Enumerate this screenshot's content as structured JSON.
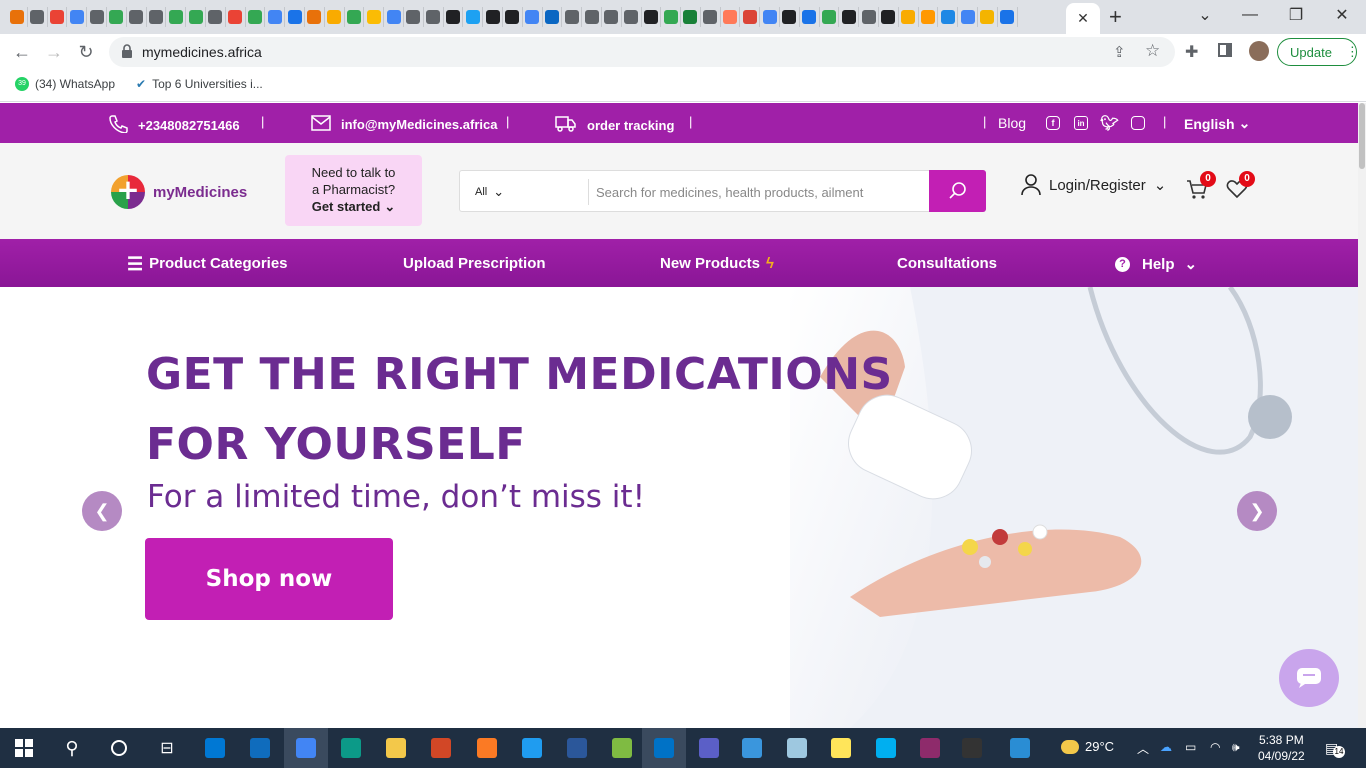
{
  "browser": {
    "url": "mymedicines.africa",
    "update_label": "Update",
    "bookmarks": [
      {
        "label": "(34) WhatsApp",
        "badge": "39"
      },
      {
        "label": "Top 6 Universities i..."
      }
    ]
  },
  "site": {
    "topbar": {
      "phone": "+2348082751466",
      "email": "info@myMedicines.africa",
      "tracking": "order tracking",
      "blog": "Blog",
      "language": "English"
    },
    "header": {
      "logo_text": "myMedicines",
      "pharmacist_line1": "Need to talk to",
      "pharmacist_line2": "a Pharmacist?",
      "pharmacist_cta": "Get started",
      "search_category": "All",
      "search_placeholder": "Search for medicines, health products, ailment",
      "login_label": "Login/Register",
      "cart_count": "0",
      "wishlist_count": "0"
    },
    "nav": {
      "categories": "Product Categories",
      "upload": "Upload Prescription",
      "new_products": "New Products",
      "consultations": "Consultations",
      "help": "Help"
    },
    "hero": {
      "headline_line1": "GET THE RIGHT MEDICATIONS",
      "headline_line2": "FOR YOURSELF",
      "subheadline": "For a limited time, don’t miss it!",
      "cta": "Shop now"
    }
  },
  "taskbar": {
    "weather": "29°C",
    "time": "5:38 PM",
    "date": "04/09/22",
    "notifications": "14"
  },
  "colors": {
    "brand_purple": "#a020a8",
    "brand_magenta": "#c21fb4",
    "headline_purple": "#6b2c91"
  }
}
